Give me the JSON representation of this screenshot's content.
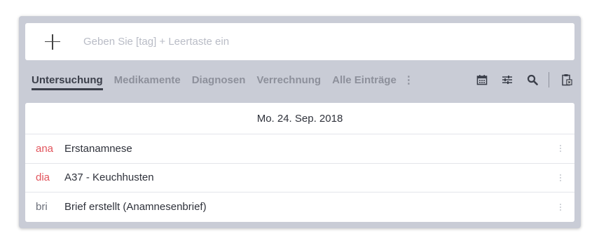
{
  "entry": {
    "add_icon": "plus-icon",
    "placeholder": "Geben Sie [tag] + Leertaste ein"
  },
  "tabs": [
    {
      "label": "Untersuchung",
      "active": true
    },
    {
      "label": "Medikamente",
      "active": false
    },
    {
      "label": "Diagnosen",
      "active": false
    },
    {
      "label": "Verrechnung",
      "active": false
    },
    {
      "label": "Alle Einträge",
      "active": false
    }
  ],
  "tabs_more_icon": "vertical-dots-icon",
  "toolbar": {
    "icons": [
      "calendar-icon",
      "sliders-icon",
      "search-icon",
      "clipboard-delete-icon"
    ]
  },
  "entries": {
    "date": "Mo. 24. Sep. 2018",
    "rows": [
      {
        "tag": "ana",
        "text": "Erstanamnese",
        "tag_color": "#e2545c"
      },
      {
        "tag": "dia",
        "text": "A37 - Keuchhusten",
        "tag_color": "#e2545c"
      },
      {
        "tag": "bri",
        "text": "Brief erstellt (Anamnesenbrief)",
        "tag_color": "#6b6f7a"
      }
    ]
  },
  "colors": {
    "panel_bg": "#c9ccd6",
    "active_tab": "#3b3f4a",
    "inactive_tab": "#8d909b",
    "accent_red": "#e2545c"
  }
}
